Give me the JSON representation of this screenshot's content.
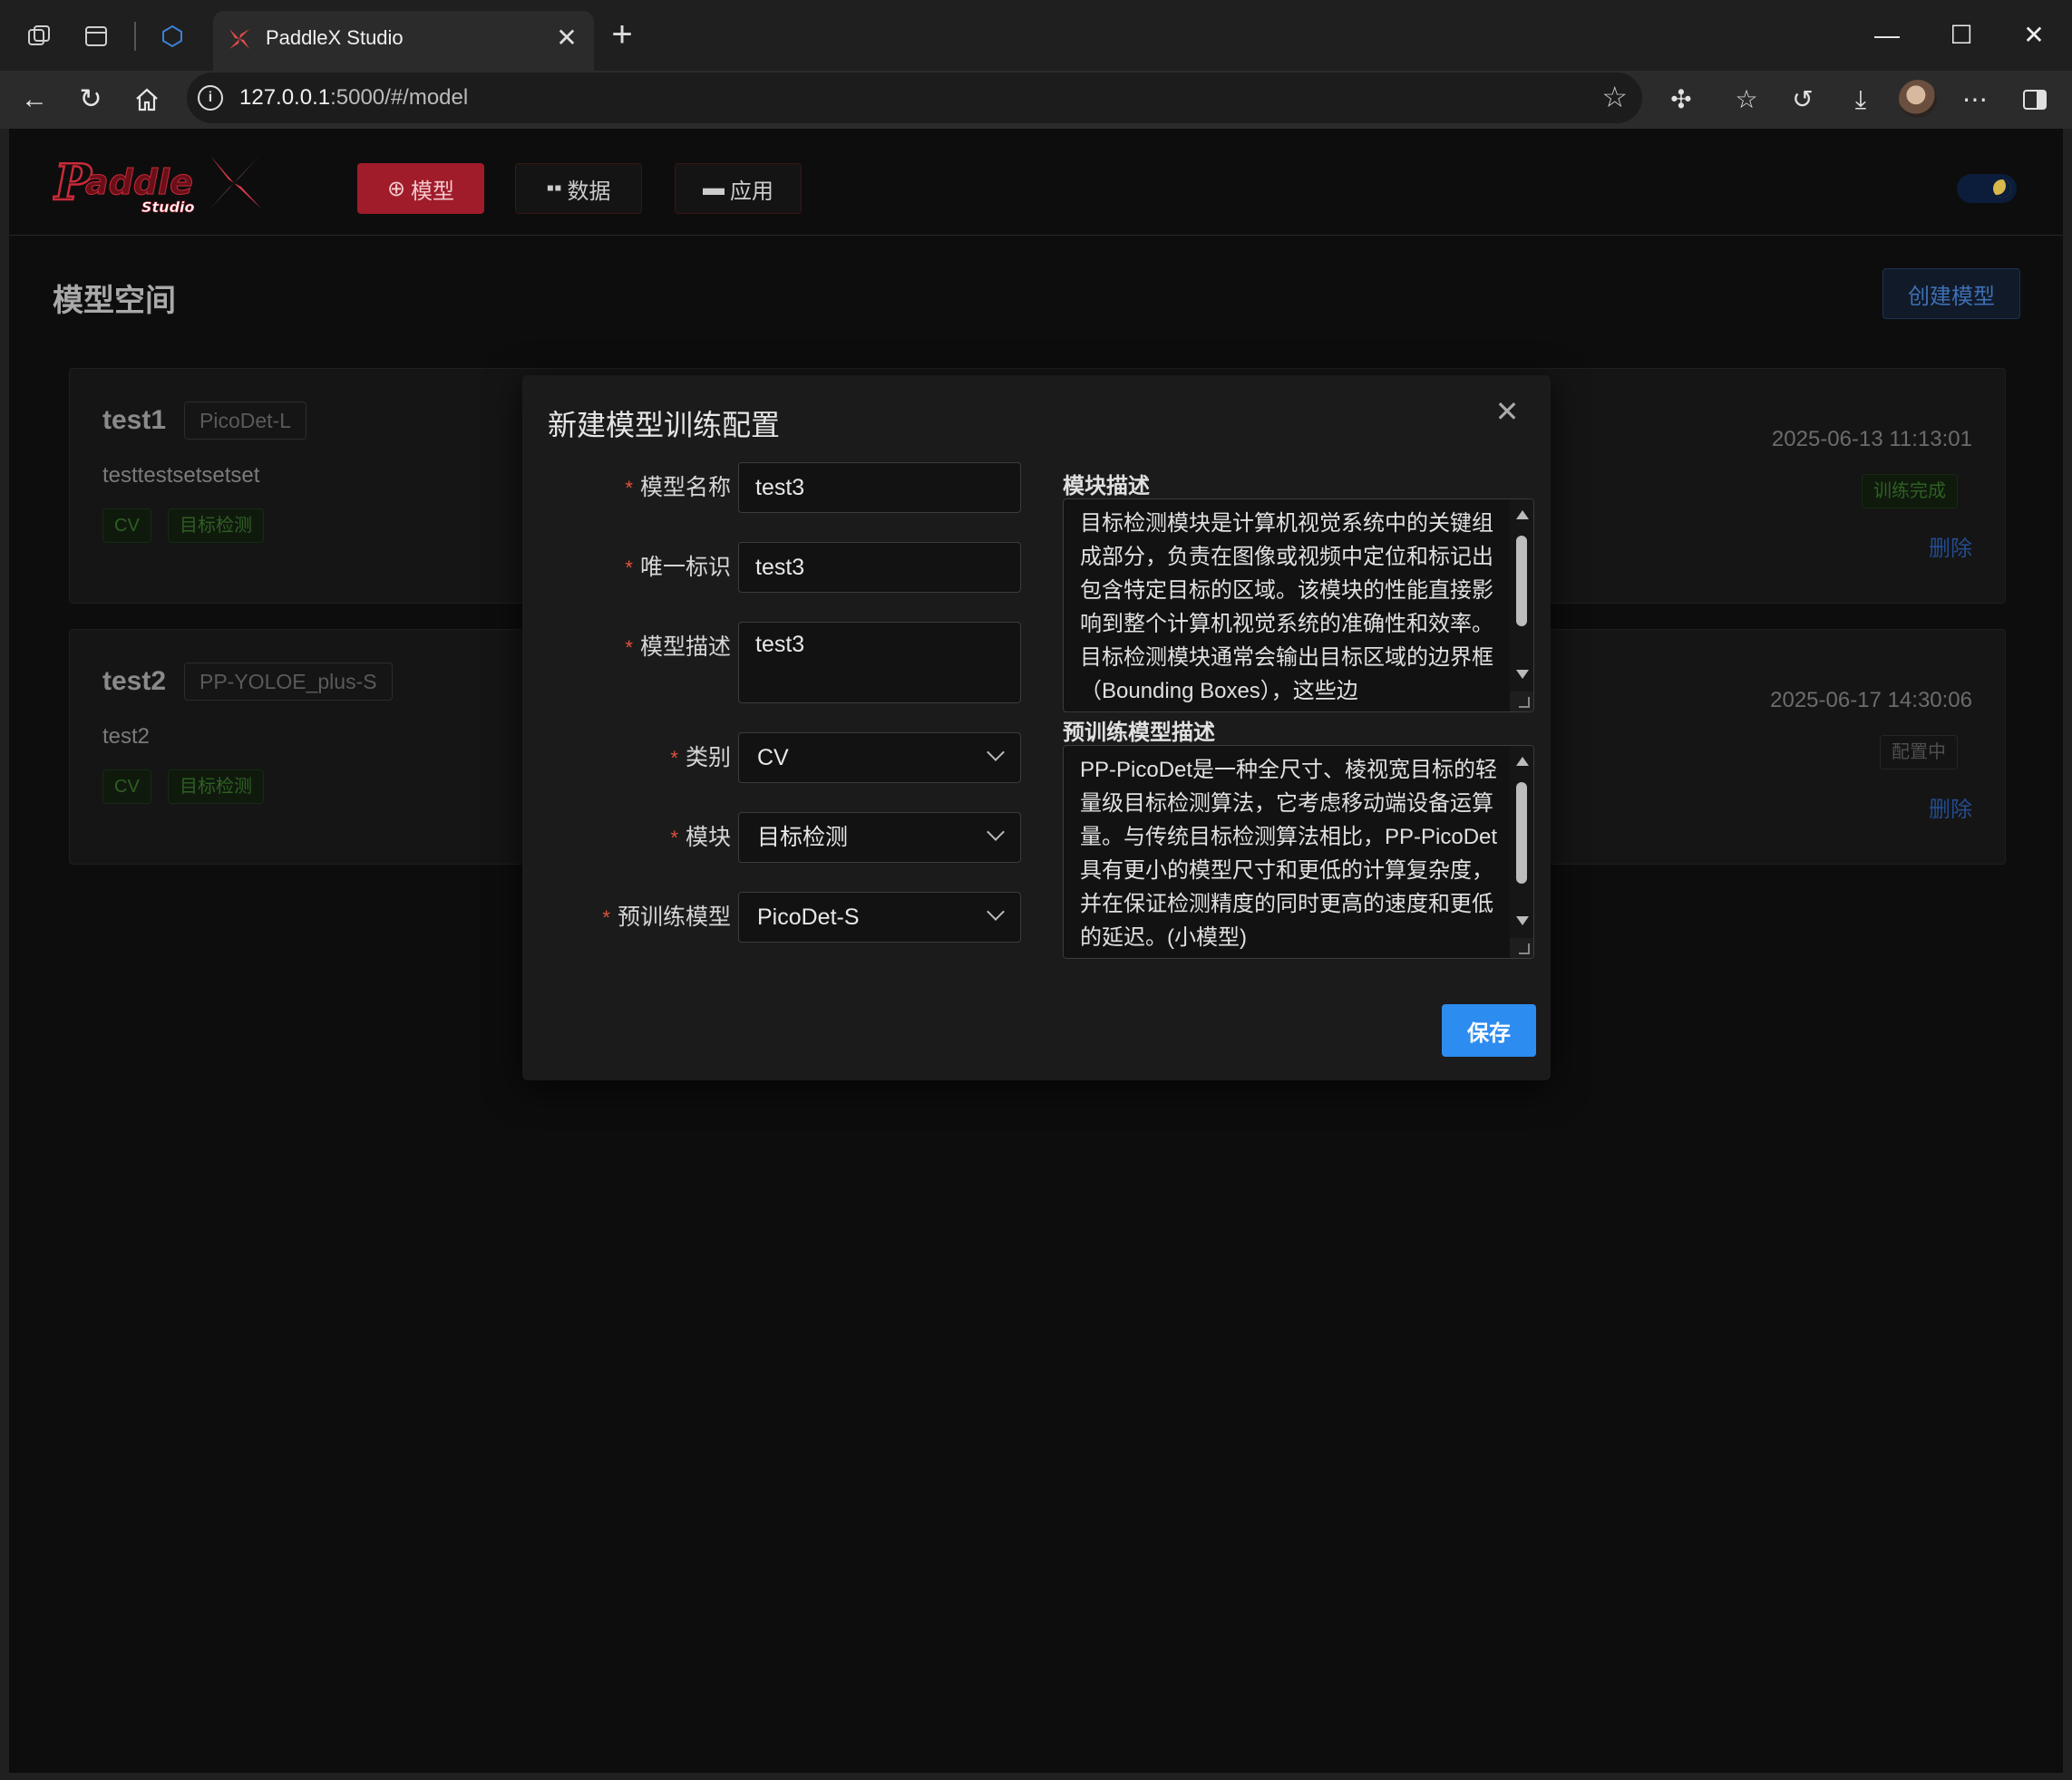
{
  "browser": {
    "tab_title": "PaddleX Studio",
    "url_host": "127.0.0.1",
    "url_rest": ":5000/#/model"
  },
  "app": {
    "nav": [
      {
        "label": "模型",
        "icon": "plus-circle-icon"
      },
      {
        "label": "数据",
        "icon": "grid-icon"
      },
      {
        "label": "应用",
        "icon": "monitor-icon"
      }
    ],
    "page_title": "模型空间",
    "create_button": "创建模型"
  },
  "models": [
    {
      "name": "test1",
      "base_model": "PicoDet-L",
      "description": "testtestsetsetset",
      "tags": [
        "CV",
        "目标检测"
      ],
      "date": "2025-06-13 11:13:01",
      "status": "训练完成",
      "delete_label": "删除"
    },
    {
      "name": "test2",
      "base_model": "PP-YOLOE_plus-S",
      "description": "test2",
      "tags": [
        "CV",
        "目标检测"
      ],
      "date": "2025-06-17 14:30:06",
      "status": "配置中",
      "delete_label": "删除"
    }
  ],
  "modal": {
    "title": "新建模型训练配置",
    "fields": {
      "model_name": {
        "label": "模型名称",
        "value": "test3"
      },
      "unique_id": {
        "label": "唯一标识",
        "value": "test3"
      },
      "model_desc": {
        "label": "模型描述",
        "value": "test3"
      },
      "category": {
        "label": "类别",
        "value": "CV"
      },
      "module": {
        "label": "模块",
        "value": "目标检测"
      },
      "pretrained": {
        "label": "预训练模型",
        "value": "PicoDet-S"
      }
    },
    "module_desc": {
      "label": "模块描述",
      "text": "目标检测模块是计算机视觉系统中的关键组成部分，负责在图像或视频中定位和标记出包含特定目标的区域。该模块的性能直接影响到整个计算机视觉系统的准确性和效率。目标检测模块通常会输出目标区域的边界框（Bounding Boxes），这些边"
    },
    "pretrained_desc": {
      "label": "预训练模型描述",
      "text": "PP-PicoDet是一种全尺寸、棱视宽目标的轻量级目标检测算法，它考虑移动端设备运算量。与传统目标检测算法相比，PP-PicoDet具有更小的模型尺寸和更低的计算复杂度，并在保证检测精度的同时更高的速度和更低的延迟。(小模型)"
    },
    "save_label": "保存",
    "accent_color": "#2d8cf0"
  }
}
